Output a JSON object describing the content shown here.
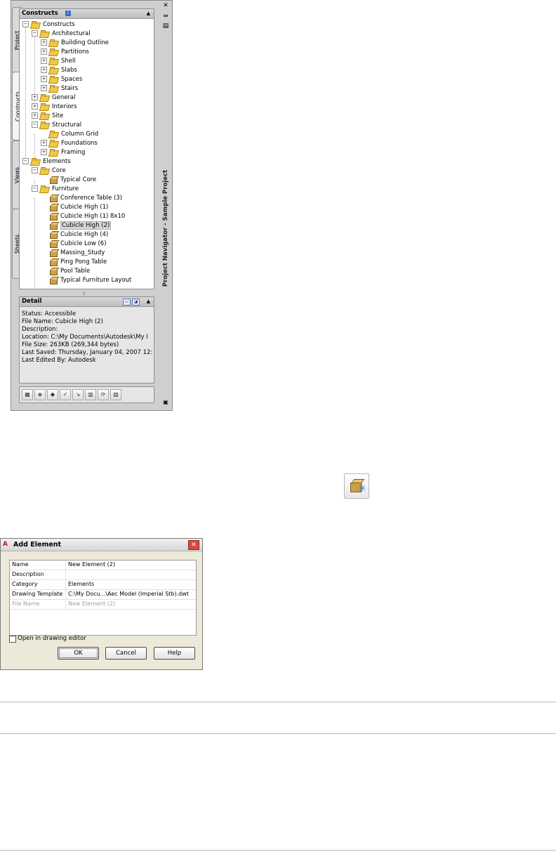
{
  "navigator": {
    "side_title": "Project Navigator - Sample Project",
    "tabs": [
      "Project",
      "Constructs",
      "Views",
      "Sheets"
    ],
    "active_tab": "Constructs",
    "tree_header": "Constructs",
    "tree": [
      {
        "label": "Constructs"
      },
      {
        "label": "Architectural"
      },
      {
        "label": "Building Outline"
      },
      {
        "label": "Partitions"
      },
      {
        "label": "Shell"
      },
      {
        "label": "Slabs"
      },
      {
        "label": "Spaces"
      },
      {
        "label": "Stairs"
      },
      {
        "label": "General"
      },
      {
        "label": "Interiors"
      },
      {
        "label": "Site"
      },
      {
        "label": "Structural"
      },
      {
        "label": "Column Grid"
      },
      {
        "label": "Foundations"
      },
      {
        "label": "Framing"
      },
      {
        "label": "Elements"
      },
      {
        "label": "Core"
      },
      {
        "label": "Typical Core"
      },
      {
        "label": "Furniture"
      },
      {
        "label": "Conference Table (3)"
      },
      {
        "label": "Cubicle High (1)"
      },
      {
        "label": "Cubicle High (1) 8x10"
      },
      {
        "label": "Cubicle High (2)"
      },
      {
        "label": "Cubicle High (4)"
      },
      {
        "label": "Cubicle Low (6)"
      },
      {
        "label": "Massing_Study"
      },
      {
        "label": "Ping Pong Table"
      },
      {
        "label": "Pool Table"
      },
      {
        "label": "Typical Furniture Layout"
      }
    ],
    "detail_header": "Detail",
    "detail_lines": [
      "Status: Accessible",
      "File Name: Cubicle High (2)",
      "Description:",
      "Location: C:\\My Documents\\Autodesk\\My I",
      "File Size: 263KB (269,344 bytes)",
      "Last Saved: Thursday, January 04, 2007  12:",
      "Last Edited By: Autodesk"
    ]
  },
  "dialog": {
    "title": "Add Element",
    "fields": [
      {
        "key": "Name",
        "value": "New Element (2)"
      },
      {
        "key": "Description",
        "value": ""
      },
      {
        "key": "Category",
        "value": "Elements"
      },
      {
        "key": "Drawing Template",
        "value": "C:\\My Docu...\\Aec Model (Imperial Stb).dwt"
      },
      {
        "key": "File Name",
        "value": "New Element (2)"
      }
    ],
    "checkbox_label": "Open in drawing editor",
    "ok": "OK",
    "cancel": "Cancel",
    "help": "Help"
  }
}
